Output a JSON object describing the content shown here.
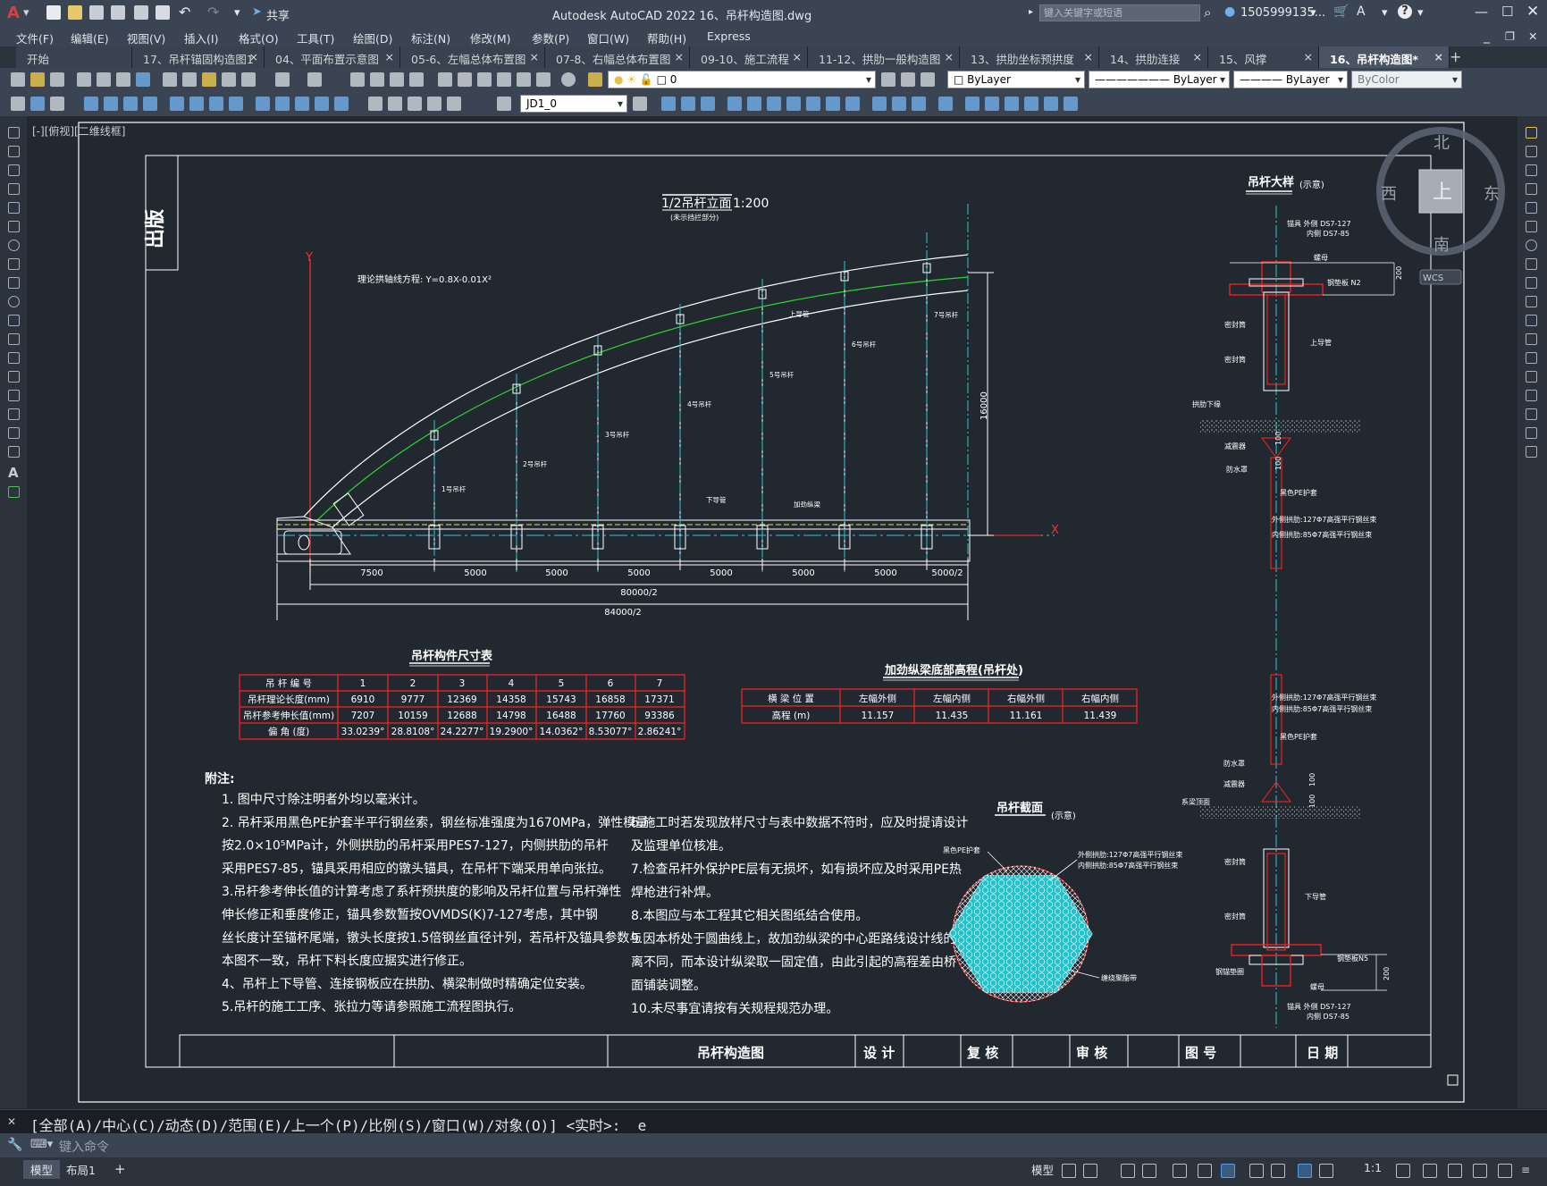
{
  "app": {
    "menu_label": "A",
    "share": "共享",
    "title": "Autodesk AutoCAD 2022    16、吊杆构造图.dwg",
    "search_placeholder": "键入关键字或短语",
    "user": "1505999135...",
    "help": "?"
  },
  "menu": [
    "文件(F)",
    "编辑(E)",
    "视图(V)",
    "插入(I)",
    "格式(O)",
    "工具(T)",
    "绘图(D)",
    "标注(N)",
    "修改(M)",
    "参数(P)",
    "窗口(W)",
    "帮助(H)",
    "Express"
  ],
  "tabs": [
    {
      "label": "开始",
      "close": ""
    },
    {
      "label": "17、吊杆锚固构造图1",
      "close": "×"
    },
    {
      "label": "04、平面布置示意图",
      "close": "×"
    },
    {
      "label": "05-6、左幅总体布置图",
      "close": "×"
    },
    {
      "label": "07-8、右幅总体布置图",
      "close": "×"
    },
    {
      "label": "09-10、施工流程",
      "close": "×"
    },
    {
      "label": "11-12、拱肋一般构造图",
      "close": "×"
    },
    {
      "label": "13、拱肋坐标预拱度",
      "close": "×"
    },
    {
      "label": "14、拱肋连接",
      "close": "×"
    },
    {
      "label": "15、风撑",
      "close": "×"
    },
    {
      "label": "16、吊杆构造图*",
      "close": "×"
    }
  ],
  "tab_add": "+",
  "toolbar": {
    "layer": "0",
    "color": "ByLayer",
    "linetype": "ByLayer",
    "lineweight": "ByLayer",
    "plotstyle": "ByColor",
    "textstyle": "JD1_0"
  },
  "viewport_label": "[-][俯视][二维线框]",
  "compass": {
    "n": "北",
    "s": "南",
    "e": "东",
    "w": "西",
    "center": "上",
    "ucs": "WCS"
  },
  "drawing": {
    "side_tab": "出版",
    "elev_title": "1/2吊杆立面",
    "elev_scale": "1:200",
    "elev_sub": "(未示挡拦部分)",
    "y_axis": "Y",
    "x_axis": "X",
    "arch_eq": "理论拱轴线方程: Y=0.8X-0.01X²",
    "hanger_labels": [
      "1号吊杆",
      "2号吊杆",
      "3号吊杆",
      "4号吊杆",
      "5号吊杆",
      "6号吊杆",
      "7号吊杆"
    ],
    "deck_labels": {
      "lower": "下导管",
      "stiff": "加劲纵梁",
      "upper": "上导管"
    },
    "height_dim": "16000",
    "spacing_dims": [
      "7500",
      "5000",
      "5000",
      "5000",
      "5000",
      "5000",
      "5000",
      "5000/2"
    ],
    "total_dims": [
      "80000/2",
      "84000/2"
    ],
    "detail_title": "吊杆大样",
    "detail_note": "(示意)",
    "detail_labels": {
      "anchor_top": "锚具 外侧 DS7-127",
      "anchor_top2": "内侧 DS7-85",
      "nut": "螺母",
      "plate_top": "钢垫板 N2",
      "upper_tube": "上导管",
      "seal1": "密封筒",
      "seal2": "密封筒",
      "arch_bottom": "拱肋下缘",
      "damper": "减震器",
      "waterproof": "防水罩",
      "pe": "黑色PE护套",
      "cable_outer": "外侧拱肋:127Φ7高强平行钢丝束",
      "cable_inner": "内侧拱肋:85Φ7高强平行钢丝束",
      "cable_outer2": "外侧拱肋:127Φ7高强平行钢丝束",
      "cable_inner2": "内侧拱肋:85Φ7高强平行钢丝束",
      "pe2": "黑色PE护套",
      "waterproof2": "防水罩",
      "damper2": "减震器",
      "beam_top": "系梁顶面",
      "seal3": "密封筒",
      "seal4": "密封筒",
      "lower_tube": "下导管",
      "plate_bot": "钢垫板N5",
      "ring": "钢锚垫圈",
      "nut2": "螺母",
      "anchor_bot": "锚具 外侧 DS7-127",
      "anchor_bot2": "内侧 DS7-85",
      "dim_200": "200",
      "dim_100a": "100",
      "dim_100b": "100",
      "dim_100c": "100",
      "dim_100d": "100",
      "dim_200b": "200"
    },
    "section_title": "吊杆截面",
    "section_note": "(示意)",
    "section_labels": {
      "pe": "黑色PE护套",
      "outer": "外侧拱肋:127Φ7高强平行钢丝束",
      "inner": "内侧拱肋:85Φ7高强平行钢丝束",
      "wrap": "缠绕聚酯带"
    },
    "size_table": {
      "title": "吊杆构件尺寸表",
      "header": [
        "吊 杆 编 号",
        "1",
        "2",
        "3",
        "4",
        "5",
        "6",
        "7"
      ],
      "rows": [
        [
          "吊杆理论长度(mm)",
          "6910",
          "9777",
          "12369",
          "14358",
          "15743",
          "16858",
          "17371"
        ],
        [
          "吊杆参考伸长值(mm)",
          "7207",
          "10159",
          "12688",
          "14798",
          "16488",
          "17760",
          "93386"
        ],
        [
          "偏    角  (度)",
          "33.0239°",
          "28.8108°",
          "24.2277°",
          "19.2900°",
          "14.0362°",
          "8.53077°",
          "2.86241°"
        ]
      ]
    },
    "elev_table": {
      "title": "加劲纵梁底部高程(吊杆处)",
      "header": [
        "横 梁 位 置",
        "左幅外侧",
        "左幅内侧",
        "右幅外侧",
        "右幅内侧"
      ],
      "rows": [
        [
          "高程 (m)",
          "11.157",
          "11.435",
          "11.161",
          "11.439"
        ]
      ]
    },
    "notes_title": "附注:",
    "notes_left": [
      "1. 图中尺寸除注明者外均以毫米计。",
      "2. 吊杆采用黑色PE护套半平行钢丝索，钢丝标准强度为1670MPa，弹性模量",
      "   按2.0×10⁵MPa计，外侧拱肋的吊杆采用PES7-127，内侧拱肋的吊杆",
      "   采用PES7-85，锚具采用相应的镦头锚具，在吊杆下端采用单向张拉。",
      "3.吊杆参考伸长值的计算考虑了系杆预拱度的影响及吊杆位置与吊杆弹性",
      "   伸长修正和垂度修正，锚具参数暂按OVMDS(K)7-127考虑，其中钢",
      "   丝长度计至锚杯尾端，镦头长度按1.5倍钢丝直径计列，若吊杆及锚具参数与",
      "   本图不一致，吊杆下料长度应据实进行修正。",
      "4、吊杆上下导管、连接钢板应在拱肋、横梁制做时精确定位安装。",
      "5.吊杆的施工工序、张拉力等请参照施工流程图执行。"
    ],
    "notes_right": [
      "6.施工时若发现放样尺寸与表中数据不符时，应及时提请设计",
      "   及监理单位核准。",
      "7.检查吊杆外保护PE层有无损坏，如有损坏应及时采用PE热",
      "   焊枪进行补焊。",
      "8.本图应与本工程其它相关图纸结合使用。",
      "9.因本桥处于圆曲线上，故加劲纵梁的中心距路线设计线的距",
      "   离不同，而本设计纵梁取一固定值，由此引起的高程差由桥",
      "   面铺装调整。",
      "10.未尽事宜请按有关规程规范办理。"
    ],
    "titleblock": [
      "吊杆构造图",
      "设 计",
      "复 核",
      "审 核",
      "图 号",
      "日 期"
    ]
  },
  "command": {
    "history": "[全部(A)/中心(C)/动态(D)/范围(E)/上一个(P)/比例(S)/窗口(W)/对象(O)] <实时>: _e",
    "placeholder": "键入命令"
  },
  "status": {
    "model": "模型",
    "layout1": "布局1",
    "add": "+",
    "scale": "1:1"
  },
  "colors": {
    "bg": "#212830",
    "accent_red": "#ff2020",
    "cyan": "#2ec4d0",
    "green": "#28c828",
    "white": "#ffffff"
  }
}
